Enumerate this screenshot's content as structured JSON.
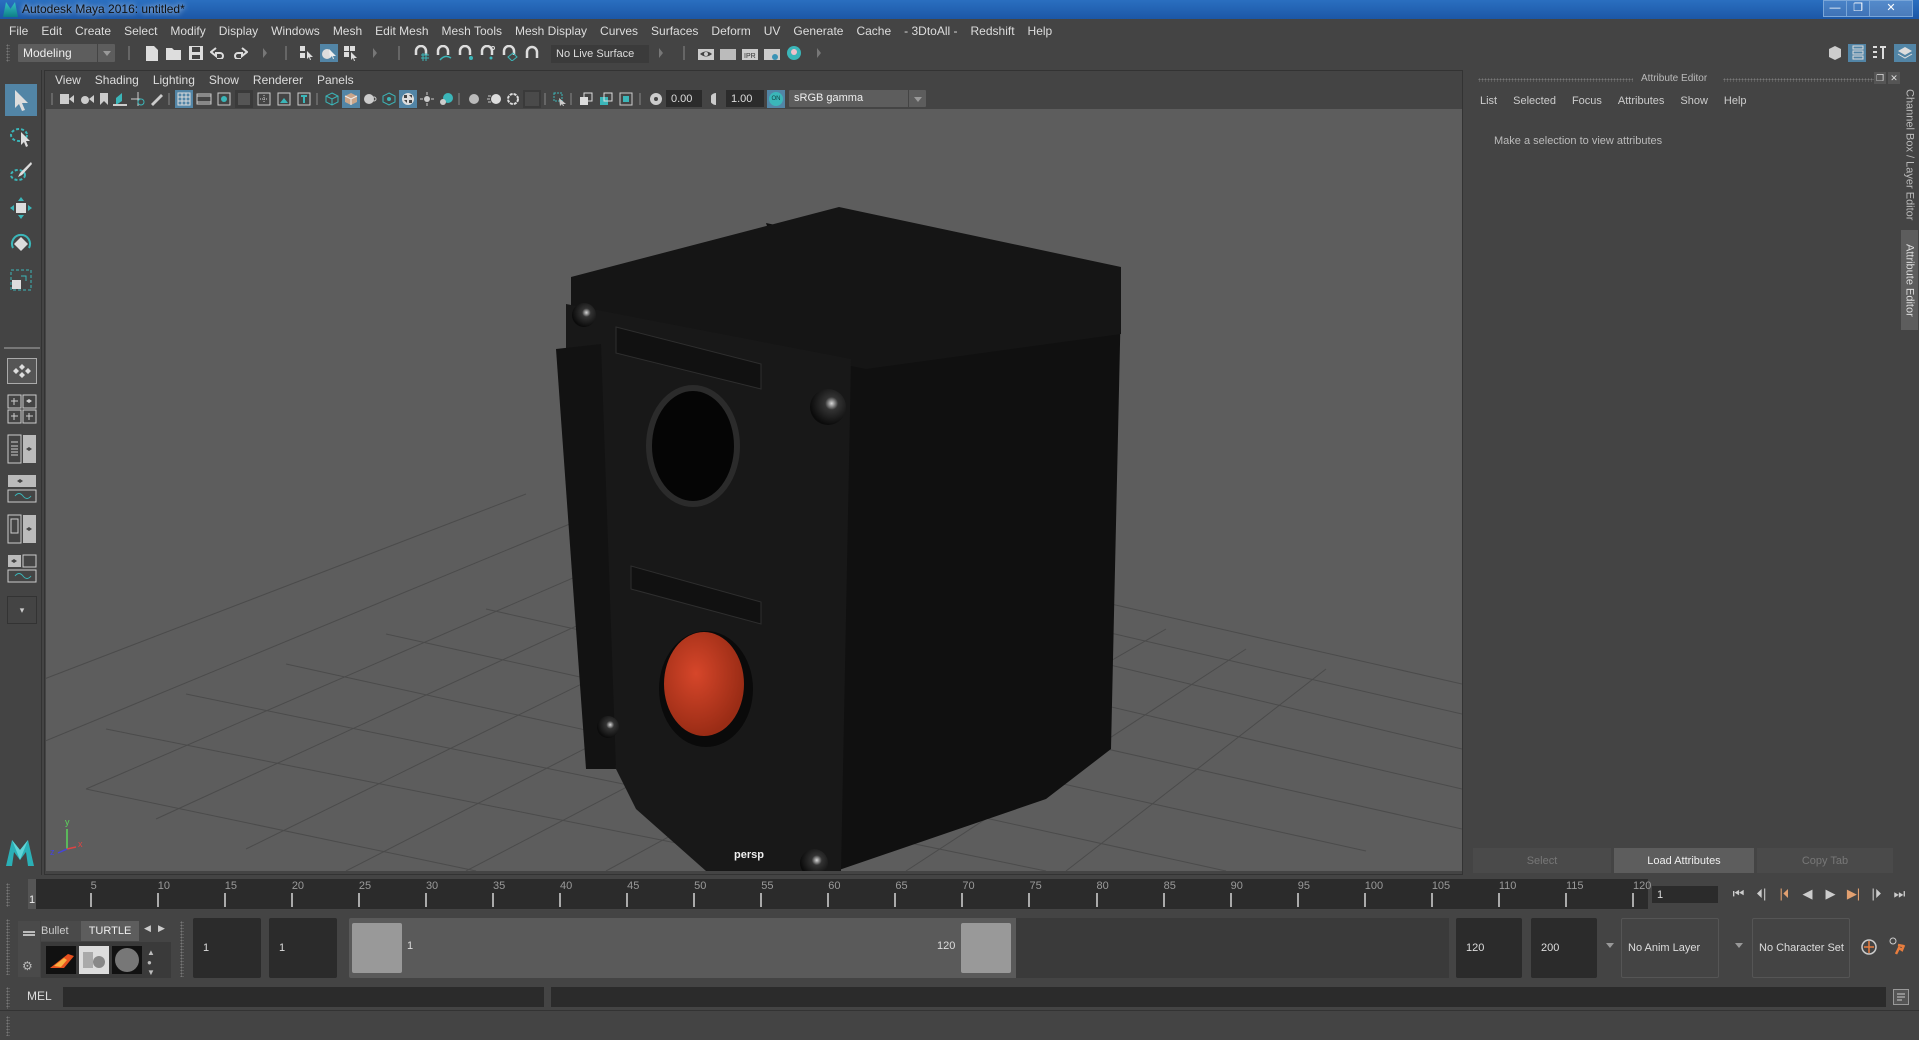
{
  "window": {
    "title": "Autodesk Maya 2016: untitled*",
    "controls": {
      "minimize": "—",
      "maximize": "❐",
      "close": "✕"
    }
  },
  "menubar": [
    "File",
    "Edit",
    "Create",
    "Select",
    "Modify",
    "Display",
    "Windows",
    "Mesh",
    "Edit Mesh",
    "Mesh Tools",
    "Mesh Display",
    "Curves",
    "Surfaces",
    "Deform",
    "UV",
    "Generate",
    "Cache",
    "- 3DtoAll -",
    "Redshift",
    "Help"
  ],
  "shelf": {
    "mode": "Modeling",
    "live_surface": "No Live Surface",
    "icons": [
      "new-scene-icon",
      "open-scene-icon",
      "save-scene-icon",
      "undo-icon",
      "redo-icon",
      "select-by-hierarchy-icon",
      "select-by-object-icon",
      "select-by-component-icon",
      "snap-to-grid-icon",
      "snap-to-curve-icon",
      "snap-to-point-icon",
      "snap-to-view-plane-icon",
      "snap-to-surface-icon",
      "make-live-icon",
      "render-view-icon",
      "render-current-frame-icon",
      "ipr-render-icon",
      "render-settings-icon",
      "hypershade-icon"
    ]
  },
  "toolbox": {
    "tools": [
      "select-tool-icon",
      "lasso-tool-icon",
      "paint-select-tool-icon",
      "move-tool-icon",
      "rotate-tool-icon",
      "scale-tool-icon"
    ],
    "layouts": [
      "single-perspective-layout-icon",
      "four-view-layout-icon",
      "persp-outliner-layout-icon",
      "persp-graph-layout-icon",
      "hypershade-layout-icon",
      "persp-graph-hypershade-layout-icon",
      "more-layouts-icon"
    ],
    "more_label": "▾"
  },
  "viewport": {
    "menu": [
      "View",
      "Shading",
      "Lighting",
      "Show",
      "Renderer",
      "Panels"
    ],
    "exposure": "0.00",
    "gamma": "1.00",
    "color_mgmt_badge": "ON",
    "color_space": "sRGB gamma",
    "camera_label": "persp",
    "axis": {
      "y": "y",
      "x": "x",
      "z": "z"
    },
    "colors": {
      "button_red": "#c8391e",
      "model_body": "#141414",
      "background": "#5d5d5d",
      "grid": "#4a4a4a"
    }
  },
  "attribute_editor": {
    "title": "Attribute Editor",
    "menu": [
      "List",
      "Selected",
      "Focus",
      "Attributes",
      "Show",
      "Help"
    ],
    "message": "Make a selection to view attributes",
    "buttons": {
      "select": "Select",
      "load": "Load Attributes",
      "copy": "Copy Tab"
    }
  },
  "side_tabs": {
    "channel_box": "Channel Box / Layer Editor",
    "attribute_editor": "Attribute Editor"
  },
  "timeline": {
    "ticks": [
      5,
      10,
      15,
      20,
      25,
      30,
      35,
      40,
      45,
      50,
      55,
      60,
      65,
      70,
      75,
      80,
      85,
      90,
      95,
      100,
      105,
      110,
      115,
      120
    ],
    "current_frame_label": "1",
    "min": 1,
    "max": 120,
    "current_frame_field": "1"
  },
  "playback": [
    "go-to-start-icon",
    "step-back-frame-icon",
    "step-back-key-icon",
    "play-backward-icon",
    "play-forward-icon",
    "step-forward-key-icon",
    "step-forward-frame-icon",
    "go-to-end-icon"
  ],
  "range": {
    "shelf_tabs": [
      "Bullet",
      "TURTLE"
    ],
    "start_time": "1",
    "playback_start": "1",
    "range_start_label": "1",
    "range_end_label": "120",
    "playback_end": "120",
    "end_time": "200",
    "anim_layer": "No Anim Layer",
    "character_set": "No Character Set"
  },
  "command_line": {
    "language": "MEL",
    "input": "",
    "result": ""
  },
  "help_line": ""
}
